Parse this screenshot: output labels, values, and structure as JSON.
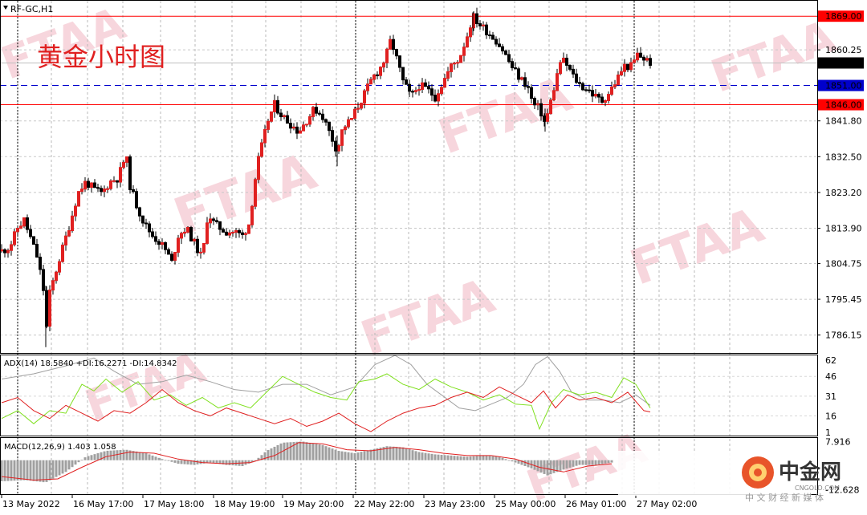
{
  "symbol": "RF-GC,H1",
  "overlay_title": "黄金小时图",
  "watermark": "FTAA",
  "logo": {
    "name": "中金网",
    "url": "CNGOLD.COM",
    "tagline": "中 文 财 经 新 媒 体"
  },
  "chart_data": [
    {
      "type": "candlestick",
      "title": "RF-GC,H1",
      "ylim": [
        1781.5,
        1873.0
      ],
      "price_ticks": [
        "1860.25",
        "1841.80",
        "1832.50",
        "1823.20",
        "1813.90",
        "1804.75",
        "1795.45",
        "1786.15"
      ],
      "price_tick_values": [
        1860.25,
        1841.8,
        1832.5,
        1823.2,
        1813.9,
        1804.75,
        1795.45,
        1786.15
      ],
      "current_price": "1856.85",
      "current_price_value": 1856.85,
      "levels": [
        {
          "label": "1869.00",
          "value": 1869.0,
          "color": "#ff0000",
          "style": "solid"
        },
        {
          "label": "1851.00",
          "value": 1851.0,
          "color": "#0000cc",
          "style": "dashed"
        },
        {
          "label": "1846.00",
          "value": 1846.0,
          "color": "#ff0000",
          "style": "solid"
        }
      ],
      "x_labels": [
        "13 May 2022",
        "16 May 17:00",
        "17 May 18:00",
        "18 May 19:00",
        "19 May 20:00",
        "22 May 22:00",
        "23 May 23:00",
        "25 May 00:00",
        "26 May 01:00",
        "27 May 02:00"
      ],
      "close_path": [
        [
          0,
          1808
        ],
        [
          10,
          1809
        ],
        [
          20,
          1814
        ],
        [
          28,
          1816
        ],
        [
          35,
          1812
        ],
        [
          45,
          1806
        ],
        [
          52,
          1798
        ],
        [
          55,
          1786
        ],
        [
          60,
          1797
        ],
        [
          68,
          1803
        ],
        [
          75,
          1808
        ],
        [
          85,
          1815
        ],
        [
          95,
          1823
        ],
        [
          105,
          1826
        ],
        [
          115,
          1824
        ],
        [
          125,
          1823
        ],
        [
          135,
          1826
        ],
        [
          145,
          1827
        ],
        [
          150,
          1830
        ],
        [
          155,
          1833
        ],
        [
          160,
          1825
        ],
        [
          168,
          1820
        ],
        [
          178,
          1815
        ],
        [
          188,
          1812
        ],
        [
          198,
          1810
        ],
        [
          205,
          1808
        ],
        [
          212,
          1805
        ],
        [
          220,
          1812
        ],
        [
          230,
          1814
        ],
        [
          240,
          1810
        ],
        [
          250,
          1806
        ],
        [
          257,
          1818
        ],
        [
          265,
          1815
        ],
        [
          272,
          1814
        ],
        [
          280,
          1813
        ],
        [
          290,
          1813
        ],
        [
          300,
          1812
        ],
        [
          308,
          1815
        ],
        [
          313,
          1822
        ],
        [
          318,
          1830
        ],
        [
          325,
          1836
        ],
        [
          332,
          1842
        ],
        [
          340,
          1846
        ],
        [
          350,
          1843
        ],
        [
          360,
          1841
        ],
        [
          370,
          1839
        ],
        [
          380,
          1842
        ],
        [
          390,
          1845
        ],
        [
          400,
          1843
        ],
        [
          410,
          1838
        ],
        [
          418,
          1834
        ],
        [
          425,
          1840
        ],
        [
          435,
          1842
        ],
        [
          445,
          1846
        ],
        [
          455,
          1850
        ],
        [
          462,
          1853
        ],
        [
          470,
          1855
        ],
        [
          478,
          1858
        ],
        [
          485,
          1863
        ],
        [
          492,
          1858
        ],
        [
          500,
          1852
        ],
        [
          510,
          1848
        ],
        [
          520,
          1851
        ],
        [
          530,
          1850
        ],
        [
          540,
          1848
        ],
        [
          550,
          1852
        ],
        [
          560,
          1856
        ],
        [
          570,
          1858
        ],
        [
          580,
          1864
        ],
        [
          587,
          1869
        ],
        [
          595,
          1867
        ],
        [
          605,
          1865
        ],
        [
          615,
          1863
        ],
        [
          625,
          1860
        ],
        [
          635,
          1856
        ],
        [
          645,
          1853
        ],
        [
          655,
          1851
        ],
        [
          662,
          1846
        ],
        [
          670,
          1845
        ],
        [
          677,
          1841
        ],
        [
          683,
          1846
        ],
        [
          690,
          1852
        ],
        [
          697,
          1858
        ],
        [
          705,
          1856
        ],
        [
          713,
          1853
        ],
        [
          721,
          1851
        ],
        [
          730,
          1850
        ],
        [
          740,
          1848
        ],
        [
          748,
          1847
        ],
        [
          756,
          1849
        ],
        [
          765,
          1852
        ],
        [
          775,
          1856
        ],
        [
          785,
          1856
        ],
        [
          792,
          1859
        ],
        [
          800,
          1858
        ],
        [
          808,
          1857
        ]
      ]
    },
    {
      "type": "line",
      "title": "ADX(14) 18.5840 +DI:16.2271 -DI:14.8342",
      "ylim": [
        1,
        62
      ],
      "y_ticks": [
        "62",
        "46",
        "31",
        "16",
        "1"
      ],
      "y_tick_values": [
        62,
        46,
        31,
        16,
        1
      ],
      "series": [
        {
          "name": "ADX",
          "color": "#a0a0a0",
          "points": [
            [
              0,
              44
            ],
            [
              40,
              48
            ],
            [
              80,
              54
            ],
            [
              115,
              60
            ],
            [
              140,
              50
            ],
            [
              170,
              40
            ],
            [
              200,
              42
            ],
            [
              230,
              47
            ],
            [
              260,
              42
            ],
            [
              290,
              36
            ],
            [
              320,
              34
            ],
            [
              350,
              40
            ],
            [
              380,
              40
            ],
            [
              410,
              32
            ],
            [
              440,
              38
            ],
            [
              465,
              55
            ],
            [
              490,
              62
            ],
            [
              510,
              55
            ],
            [
              530,
              40
            ],
            [
              550,
              31
            ],
            [
              570,
              22
            ],
            [
              590,
              20
            ],
            [
              610,
              25
            ],
            [
              630,
              30
            ],
            [
              650,
              40
            ],
            [
              665,
              55
            ],
            [
              680,
              61
            ],
            [
              695,
              50
            ],
            [
              710,
              34
            ],
            [
              730,
              28
            ],
            [
              750,
              28
            ],
            [
              770,
              26
            ],
            [
              790,
              32
            ],
            [
              808,
              24
            ]
          ]
        },
        {
          "name": "+DI",
          "color": "#80e020",
          "points": [
            [
              0,
              14
            ],
            [
              20,
              20
            ],
            [
              40,
              10
            ],
            [
              60,
              20
            ],
            [
              80,
              18
            ],
            [
              100,
              40
            ],
            [
              115,
              35
            ],
            [
              130,
              44
            ],
            [
              150,
              34
            ],
            [
              170,
              42
            ],
            [
              190,
              28
            ],
            [
              210,
              32
            ],
            [
              230,
              24
            ],
            [
              250,
              30
            ],
            [
              270,
              22
            ],
            [
              290,
              26
            ],
            [
              310,
              22
            ],
            [
              330,
              34
            ],
            [
              350,
              46
            ],
            [
              370,
              40
            ],
            [
              390,
              34
            ],
            [
              410,
              30
            ],
            [
              430,
              28
            ],
            [
              445,
              42
            ],
            [
              465,
              44
            ],
            [
              480,
              48
            ],
            [
              500,
              40
            ],
            [
              520,
              36
            ],
            [
              540,
              44
            ],
            [
              560,
              38
            ],
            [
              580,
              34
            ],
            [
              600,
              28
            ],
            [
              620,
              32
            ],
            [
              640,
              25
            ],
            [
              660,
              24
            ],
            [
              670,
              6
            ],
            [
              685,
              26
            ],
            [
              700,
              36
            ],
            [
              720,
              32
            ],
            [
              740,
              34
            ],
            [
              760,
              30
            ],
            [
              775,
              45
            ],
            [
              790,
              40
            ],
            [
              808,
              22
            ]
          ]
        },
        {
          "name": "-DI",
          "color": "#e02020",
          "points": [
            [
              0,
              26
            ],
            [
              20,
              30
            ],
            [
              40,
              20
            ],
            [
              60,
              14
            ],
            [
              80,
              24
            ],
            [
              100,
              18
            ],
            [
              120,
              12
            ],
            [
              140,
              20
            ],
            [
              160,
              18
            ],
            [
              180,
              26
            ],
            [
              200,
              36
            ],
            [
              220,
              26
            ],
            [
              240,
              20
            ],
            [
              260,
              16
            ],
            [
              280,
              22
            ],
            [
              300,
              18
            ],
            [
              320,
              14
            ],
            [
              340,
              10
            ],
            [
              360,
              14
            ],
            [
              380,
              8
            ],
            [
              400,
              12
            ],
            [
              420,
              18
            ],
            [
              440,
              10
            ],
            [
              460,
              4
            ],
            [
              480,
              12
            ],
            [
              500,
              18
            ],
            [
              520,
              22
            ],
            [
              540,
              24
            ],
            [
              560,
              30
            ],
            [
              580,
              34
            ],
            [
              600,
              30
            ],
            [
              620,
              38
            ],
            [
              640,
              32
            ],
            [
              660,
              26
            ],
            [
              675,
              35
            ],
            [
              690,
              22
            ],
            [
              705,
              32
            ],
            [
              720,
              28
            ],
            [
              740,
              30
            ],
            [
              760,
              26
            ],
            [
              780,
              34
            ],
            [
              800,
              20
            ],
            [
              808,
              19
            ]
          ]
        }
      ]
    },
    {
      "type": "bar",
      "title": "MACD(12,26,9) 1.403 1.058",
      "ylim": [
        -14.5,
        9.5
      ],
      "y_ticks": [
        "7.916",
        "-12.628"
      ],
      "y_tick_values": [
        7.916,
        -12.628
      ],
      "series": [
        {
          "name": "MACD",
          "color": "#a0a0a0",
          "points": [
            [
              0,
              -9.0
            ],
            [
              30,
              -8.5
            ],
            [
              55,
              -9.5
            ],
            [
              80,
              -5.0
            ],
            [
              105,
              1.5
            ],
            [
              130,
              4.0
            ],
            [
              155,
              4.5
            ],
            [
              180,
              3.0
            ],
            [
              200,
              0.5
            ],
            [
              220,
              -1.5
            ],
            [
              240,
              -2.0
            ],
            [
              260,
              -1.0
            ],
            [
              280,
              -2.0
            ],
            [
              300,
              -2.5
            ],
            [
              315,
              -0.5
            ],
            [
              330,
              4.0
            ],
            [
              350,
              7.5
            ],
            [
              375,
              8.0
            ],
            [
              400,
              6.5
            ],
            [
              420,
              4.0
            ],
            [
              440,
              3.0
            ],
            [
              460,
              4.5
            ],
            [
              480,
              6.0
            ],
            [
              500,
              5.5
            ],
            [
              520,
              3.5
            ],
            [
              540,
              2.5
            ],
            [
              560,
              2.0
            ],
            [
              580,
              1.5
            ],
            [
              600,
              2.0
            ],
            [
              620,
              1.5
            ],
            [
              640,
              -1.0
            ],
            [
              660,
              -3.5
            ],
            [
              680,
              -6.5
            ],
            [
              700,
              -4.0
            ],
            [
              720,
              -2.0
            ],
            [
              740,
              -2.0
            ],
            [
              760,
              -1.0
            ]
          ]
        },
        {
          "name": "Signal",
          "color": "#e02020",
          "points": [
            [
              0,
              -7.0
            ],
            [
              40,
              -8.5
            ],
            [
              70,
              -8.0
            ],
            [
              100,
              -3.0
            ],
            [
              130,
              1.5
            ],
            [
              160,
              3.5
            ],
            [
              190,
              3.0
            ],
            [
              220,
              0.5
            ],
            [
              250,
              -1.0
            ],
            [
              280,
              -1.5
            ],
            [
              310,
              -1.0
            ],
            [
              340,
              2.0
            ],
            [
              370,
              7.5
            ],
            [
              400,
              7.0
            ],
            [
              430,
              4.5
            ],
            [
              460,
              4.0
            ],
            [
              490,
              5.5
            ],
            [
              520,
              4.5
            ],
            [
              550,
              3.0
            ],
            [
              580,
              2.0
            ],
            [
              610,
              2.0
            ],
            [
              640,
              0.5
            ],
            [
              670,
              -3.0
            ],
            [
              700,
              -5.0
            ],
            [
              730,
              -2.5
            ],
            [
              760,
              -1.5
            ]
          ]
        }
      ]
    }
  ]
}
